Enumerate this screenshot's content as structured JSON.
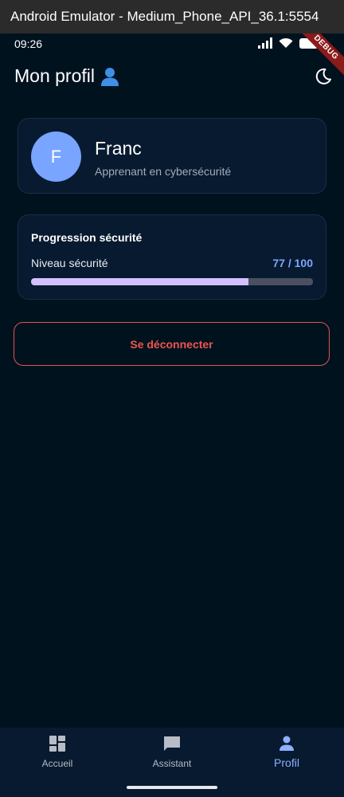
{
  "window": {
    "title": "Android Emulator - Medium_Phone_API_36.1:5554"
  },
  "statusbar": {
    "time": "09:26",
    "debug_label": "DEBUG"
  },
  "appbar": {
    "title": "Mon profil"
  },
  "profile": {
    "avatar_initial": "F",
    "name": "Franc",
    "role": "Apprenant en cybersécurité"
  },
  "progress": {
    "title": "Progression sécurité",
    "label": "Niveau sécurité",
    "value_text": "77 / 100",
    "value": 77,
    "max": 100
  },
  "logout": {
    "label": "Se déconnecter"
  },
  "bottomnav": {
    "items": [
      {
        "label": "Accueil",
        "icon": "dashboard-icon",
        "active": false
      },
      {
        "label": "Assistant",
        "icon": "chat-icon",
        "active": false
      },
      {
        "label": "Profil",
        "icon": "person-icon",
        "active": true
      }
    ]
  },
  "colors": {
    "background": "#01121f",
    "card": "#071a30",
    "avatar": "#79a4ff",
    "progress_fill": "#d2c0ff",
    "accent": "#7fa6ff",
    "danger": "#f0544c"
  }
}
